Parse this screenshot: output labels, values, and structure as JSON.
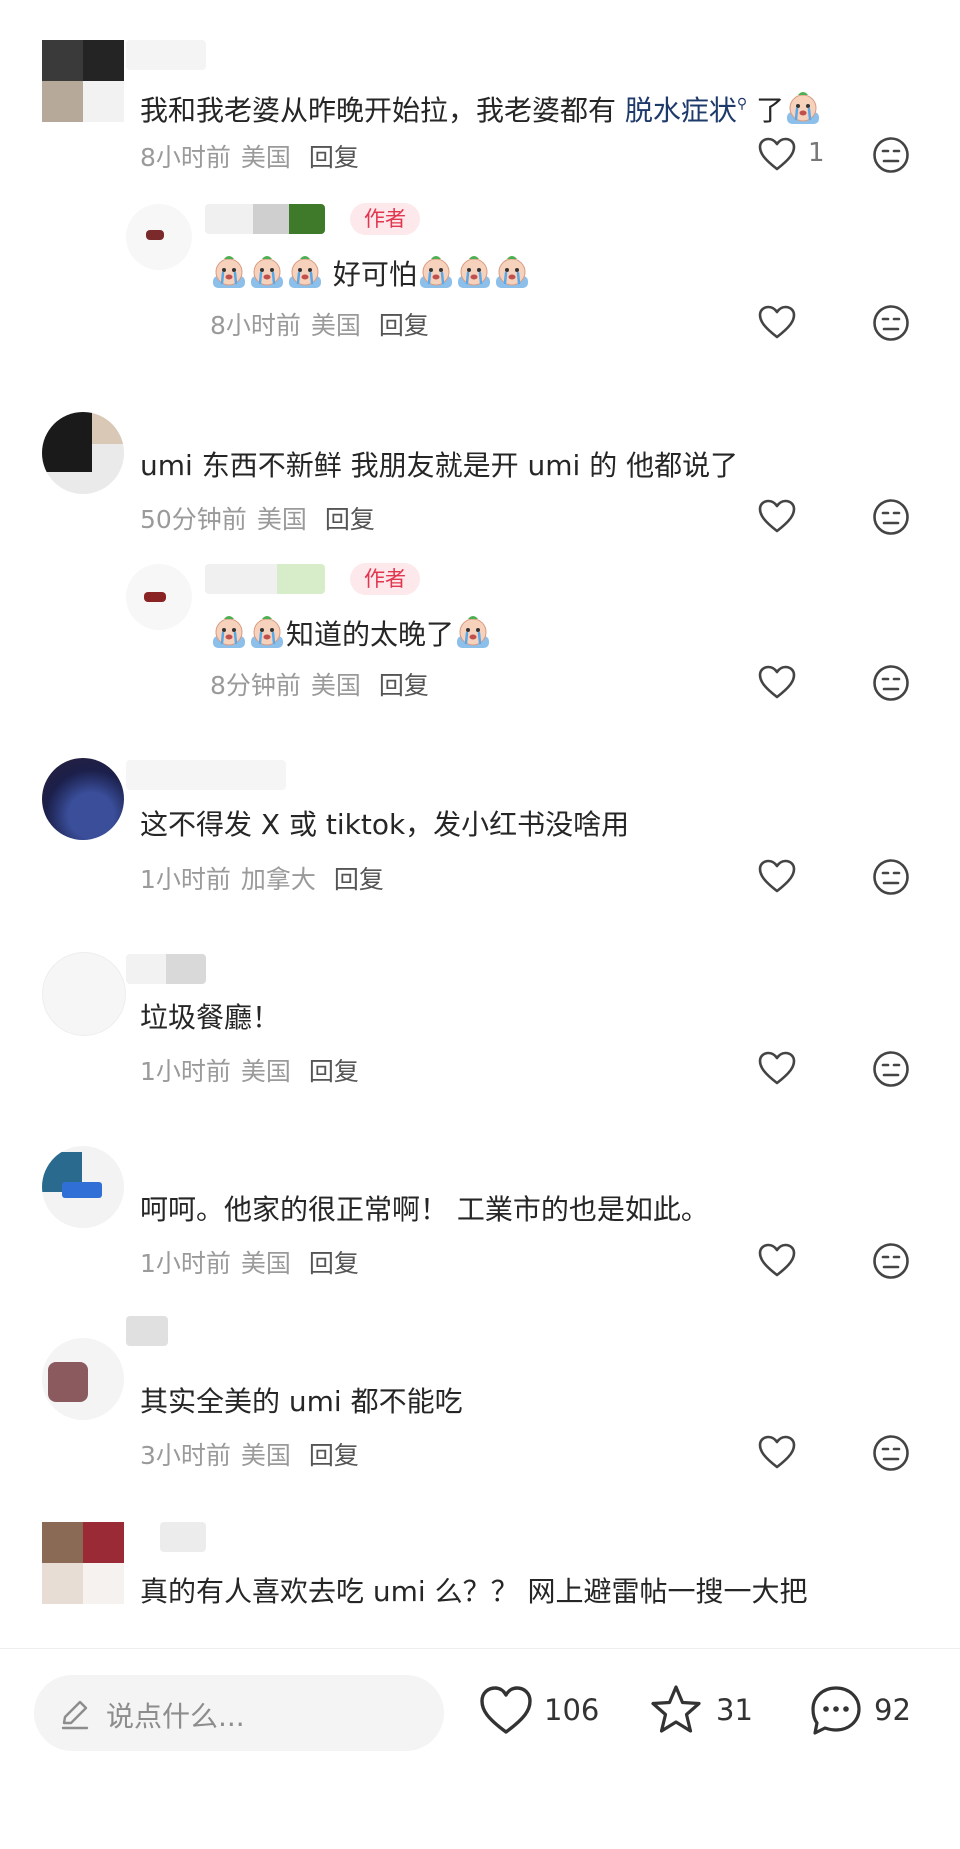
{
  "comments": [
    {
      "text_before": "我和我老婆从昨晚开始拉，我老婆都有 ",
      "link": "脱水症状",
      "text_after": " 了",
      "time": "8小时前",
      "location": "美国",
      "reply": "回复",
      "likes": "1"
    },
    {
      "badge": "作者",
      "text": "好可怕",
      "time": "8小时前",
      "location": "美国",
      "reply": "回复"
    },
    {
      "text": "umi 东西不新鲜 我朋友就是开 umi 的 他都说了",
      "time": "50分钟前",
      "location": "美国",
      "reply": "回复"
    },
    {
      "badge": "作者",
      "text": "知道的太晚了",
      "time": "8分钟前",
      "location": "美国",
      "reply": "回复"
    },
    {
      "text": "这不得发 X 或 tiktok，发小红书没啥用",
      "time": "1小时前",
      "location": "加拿大",
      "reply": "回复"
    },
    {
      "text": "垃圾餐廳！",
      "time": "1小时前",
      "location": "美国",
      "reply": "回复"
    },
    {
      "text": "呵呵。他家的很正常啊！ 工業市的也是如此。",
      "time": "1小时前",
      "location": "美国",
      "reply": "回复"
    },
    {
      "text": "其实全美的 umi 都不能吃",
      "time": "3小时前",
      "location": "美国",
      "reply": "回复"
    },
    {
      "text": "真的有人喜欢去吃 umi 么？？ 网上避雷帖一搜一大把"
    }
  ],
  "bottom_bar": {
    "placeholder": "说点什么...",
    "likes": "106",
    "stars": "31",
    "comments": "92"
  },
  "colors": {
    "author_badge": "#e2364f",
    "link": "#1e3a6b",
    "meta": "#9a9a9a"
  },
  "icons": [
    "heart-icon",
    "face-icon",
    "pencil-icon",
    "star-icon",
    "comment-bubble-icon",
    "crying-emoji"
  ]
}
